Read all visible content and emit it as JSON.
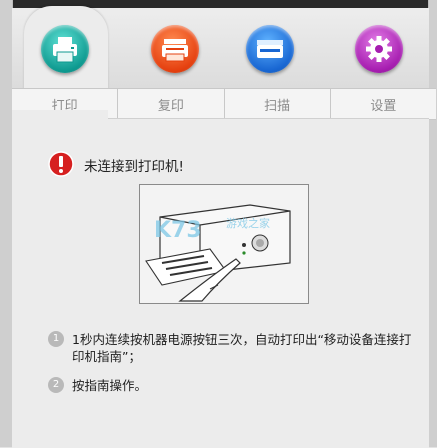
{
  "tabs": [
    {
      "label": "打印",
      "icon": "printer-icon",
      "color": "#0e9a90"
    },
    {
      "label": "复印",
      "icon": "copier-icon",
      "color": "#e5400f"
    },
    {
      "label": "扫描",
      "icon": "scanner-icon",
      "color": "#1866d2"
    },
    {
      "label": "设置",
      "icon": "settings-gear-icon",
      "color": "#a61db0"
    }
  ],
  "active_tab": "打印",
  "status": {
    "icon": "warning-icon",
    "message": "未连接到打印机!"
  },
  "illustration": {
    "watermark": "K73 游戏之家",
    "description_icon": "printer-power-button-illustration"
  },
  "steps": [
    {
      "number": "1",
      "text": "1秒内连续按机器电源按钮三次，自动打印出“移动设备连接打印机指南”；"
    },
    {
      "number": "2",
      "text": "按指南操作。"
    }
  ]
}
